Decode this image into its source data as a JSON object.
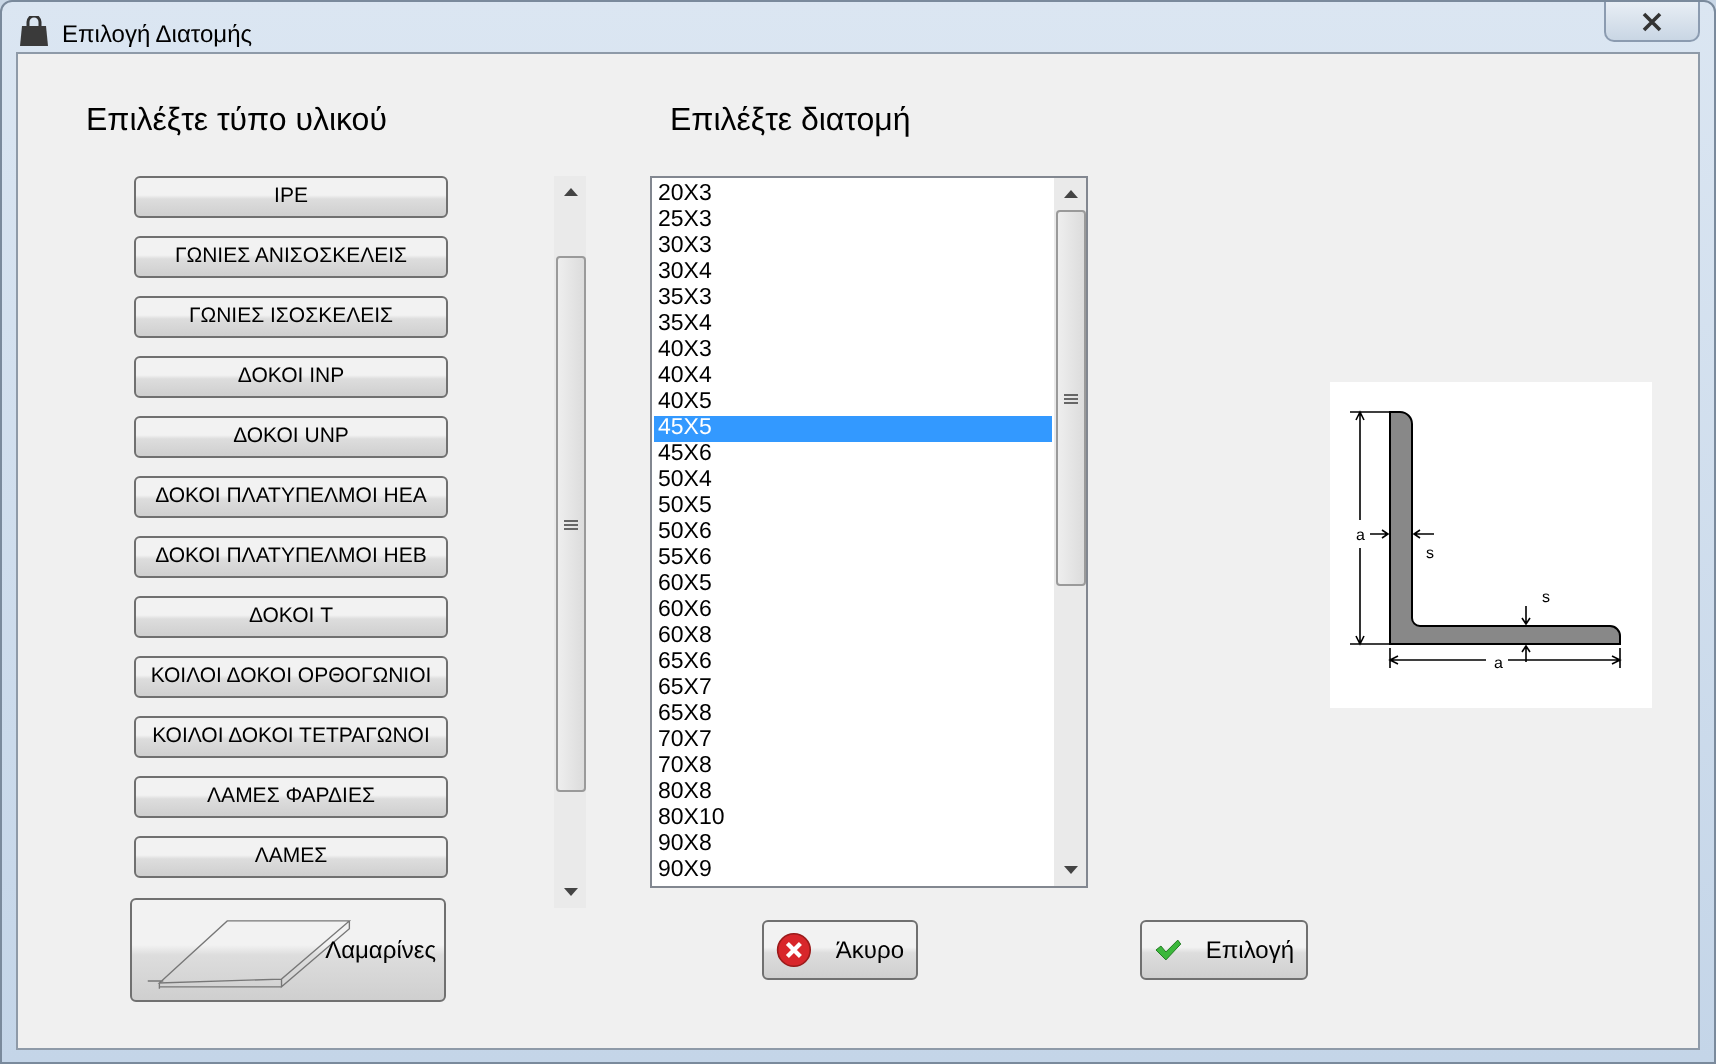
{
  "window": {
    "title": "Επιλογή Διατομής"
  },
  "material_panel": {
    "heading": "Επιλέξτε τύπο υλικού",
    "buttons": [
      {
        "label": "IPE"
      },
      {
        "label": "ΓΩΝΙΕΣ ΑΝΙΣΟΣΚΕΛΕΙΣ"
      },
      {
        "label": "ΓΩΝΙΕΣ ΙΣΟΣΚΕΛΕΙΣ"
      },
      {
        "label": "ΔΟΚΟΙ INP"
      },
      {
        "label": "ΔΟΚΟΙ UNP"
      },
      {
        "label": "ΔΟΚΟΙ ΠΛΑΤΥΠΕΛΜΟΙ HEA"
      },
      {
        "label": "ΔΟΚΟΙ ΠΛΑΤΥΠΕΛΜΟΙ HEB"
      },
      {
        "label": "ΔΟΚΟΙ T"
      },
      {
        "label": "ΚΟΙΛΟΙ ΔΟΚΟΙ ΟΡΘΟΓΩΝΙΟΙ"
      },
      {
        "label": "ΚΟΙΛΟΙ ΔΟΚΟΙ ΤΕΤΡΑΓΩΝΟΙ"
      },
      {
        "label": "ΛΑΜΕΣ ΦΑΡΔΙΕΣ"
      },
      {
        "label": "ΛΑΜΕΣ"
      }
    ]
  },
  "section_panel": {
    "heading": "Επιλέξτε διατομή",
    "items": [
      {
        "label": "20X3",
        "selected": false
      },
      {
        "label": "25X3",
        "selected": false
      },
      {
        "label": "30X3",
        "selected": false
      },
      {
        "label": "30X4",
        "selected": false
      },
      {
        "label": "35X3",
        "selected": false
      },
      {
        "label": "35X4",
        "selected": false
      },
      {
        "label": "40X3",
        "selected": false
      },
      {
        "label": "40X4",
        "selected": false
      },
      {
        "label": "40X5",
        "selected": false
      },
      {
        "label": "45X5",
        "selected": true
      },
      {
        "label": "45X6",
        "selected": false
      },
      {
        "label": "50X4",
        "selected": false
      },
      {
        "label": "50X5",
        "selected": false
      },
      {
        "label": "50X6",
        "selected": false
      },
      {
        "label": "55X6",
        "selected": false
      },
      {
        "label": "60X5",
        "selected": false
      },
      {
        "label": "60X6",
        "selected": false
      },
      {
        "label": "60X8",
        "selected": false
      },
      {
        "label": "65X6",
        "selected": false
      },
      {
        "label": "65X7",
        "selected": false
      },
      {
        "label": "65X8",
        "selected": false
      },
      {
        "label": "70X7",
        "selected": false
      },
      {
        "label": "70X8",
        "selected": false
      },
      {
        "label": "80X8",
        "selected": false
      },
      {
        "label": "80X10",
        "selected": false
      },
      {
        "label": "90X8",
        "selected": false
      },
      {
        "label": "90X9",
        "selected": false
      }
    ]
  },
  "diagram": {
    "labels": [
      "a",
      "s",
      "s",
      "a"
    ]
  },
  "sheet_button": {
    "label": "Λαμαρίνες"
  },
  "buttons": [
    {
      "label": "Άκυρο",
      "kind": "cancel"
    },
    {
      "label": "Επιλογή",
      "kind": "ok"
    }
  ]
}
